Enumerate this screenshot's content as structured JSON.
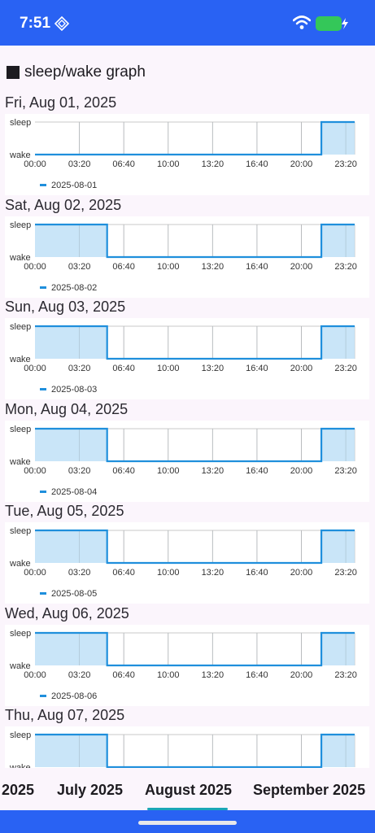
{
  "status_bar": {
    "time": "7:51",
    "background_color": "#2962f3"
  },
  "page": {
    "title": "sleep/wake graph"
  },
  "chart_data": {
    "type": "area",
    "y_categories": [
      "wake",
      "sleep"
    ],
    "x_tick_labels": [
      "00:00",
      "03:20",
      "06:40",
      "10:00",
      "13:20",
      "16:40",
      "20:00",
      "23:20"
    ],
    "xlim_minutes": [
      0,
      1440
    ],
    "grid": true,
    "legend_position": "bottom-left",
    "line_color": "#1f8fdc",
    "fill_color": "#bfe0f7",
    "days": [
      {
        "heading": "Fri, Aug 01, 2025",
        "legend": "2025-08-01",
        "x_minutes": [
          0,
          1290,
          1290,
          1440
        ],
        "y_values": [
          0,
          0,
          1,
          1
        ]
      },
      {
        "heading": "Sat, Aug 02, 2025",
        "legend": "2025-08-02",
        "x_minutes": [
          0,
          325,
          325,
          1290,
          1290,
          1440
        ],
        "y_values": [
          1,
          1,
          0,
          0,
          1,
          1
        ]
      },
      {
        "heading": "Sun, Aug 03, 2025",
        "legend": "2025-08-03",
        "x_minutes": [
          0,
          325,
          325,
          1290,
          1290,
          1440
        ],
        "y_values": [
          1,
          1,
          0,
          0,
          1,
          1
        ]
      },
      {
        "heading": "Mon, Aug 04, 2025",
        "legend": "2025-08-04",
        "x_minutes": [
          0,
          325,
          325,
          1290,
          1290,
          1440
        ],
        "y_values": [
          1,
          1,
          0,
          0,
          1,
          1
        ]
      },
      {
        "heading": "Tue, Aug 05, 2025",
        "legend": "2025-08-05",
        "x_minutes": [
          0,
          325,
          325,
          1290,
          1290,
          1440
        ],
        "y_values": [
          1,
          1,
          0,
          0,
          1,
          1
        ]
      },
      {
        "heading": "Wed, Aug 06, 2025",
        "legend": "2025-08-06",
        "x_minutes": [
          0,
          325,
          325,
          1290,
          1290,
          1440
        ],
        "y_values": [
          1,
          1,
          0,
          0,
          1,
          1
        ]
      },
      {
        "heading": "Thu, Aug 07, 2025",
        "legend": "2025-08-07",
        "x_minutes": [
          0,
          325,
          325,
          1290,
          1290,
          1440
        ],
        "y_values": [
          1,
          1,
          0,
          0,
          1,
          1
        ]
      }
    ]
  },
  "month_tabs": {
    "items": [
      {
        "label": "2025",
        "selected": false
      },
      {
        "label": "July 2025",
        "selected": false
      },
      {
        "label": "August 2025",
        "selected": true
      },
      {
        "label": "September 2025",
        "selected": false
      }
    ],
    "indicator_color": "#1aa6b7"
  }
}
